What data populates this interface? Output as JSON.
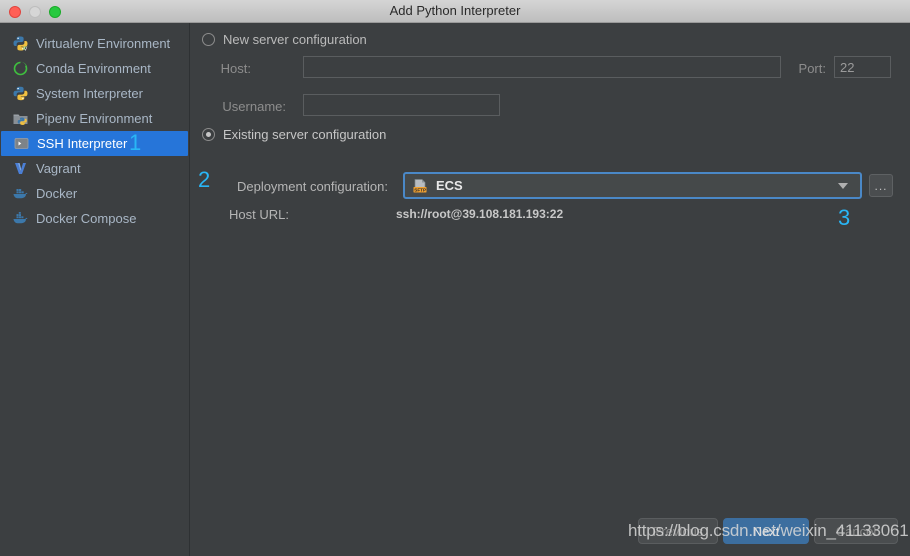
{
  "window": {
    "title": "Add Python Interpreter",
    "traffic_lights": [
      "close",
      "minimize",
      "maximize"
    ]
  },
  "sidebar": {
    "items": [
      {
        "label": "Virtualenv Environment",
        "icon": "python-virtualenv-icon",
        "selected": false
      },
      {
        "label": "Conda Environment",
        "icon": "conda-icon",
        "selected": false
      },
      {
        "label": "System Interpreter",
        "icon": "python-icon",
        "selected": false
      },
      {
        "label": "Pipenv Environment",
        "icon": "pipenv-folder-icon",
        "selected": false
      },
      {
        "label": "SSH Interpreter",
        "icon": "ssh-terminal-icon",
        "selected": true
      },
      {
        "label": "Vagrant",
        "icon": "vagrant-icon",
        "selected": false
      },
      {
        "label": "Docker",
        "icon": "docker-whale-icon",
        "selected": false
      },
      {
        "label": "Docker Compose",
        "icon": "docker-compose-icon",
        "selected": false
      }
    ]
  },
  "main": {
    "new_server": {
      "radio_label": "New server configuration",
      "selected": false,
      "host_label": "Host:",
      "host_value": "",
      "port_label": "Port:",
      "port_value": "22",
      "username_label": "Username:",
      "username_value": ""
    },
    "existing_server": {
      "radio_label": "Existing server configuration",
      "selected": true,
      "deployment_label": "Deployment configuration:",
      "deployment_value": "ECS",
      "deployment_icon": "sftp-server-icon",
      "browse_label": "...",
      "host_url_label": "Host URL:",
      "host_url_value": "ssh://root@39.108.181.193:22"
    }
  },
  "annotations": [
    {
      "text": "1",
      "color": "#29b6f6"
    },
    {
      "text": "2",
      "color": "#29b6f6"
    },
    {
      "text": "3",
      "color": "#29b6f6"
    }
  ],
  "footer": {
    "previous_label": "Previous",
    "next_label": "Next",
    "cancel_label": "Cancel"
  },
  "watermark": {
    "text": "https://blog.csdn.net/weixin_41133061"
  },
  "colors": {
    "background": "#3c3f41",
    "selection": "#2675d9",
    "accent": "#4a88c7",
    "annotation": "#29b6f6",
    "primary_button": "#3c6e9f"
  }
}
